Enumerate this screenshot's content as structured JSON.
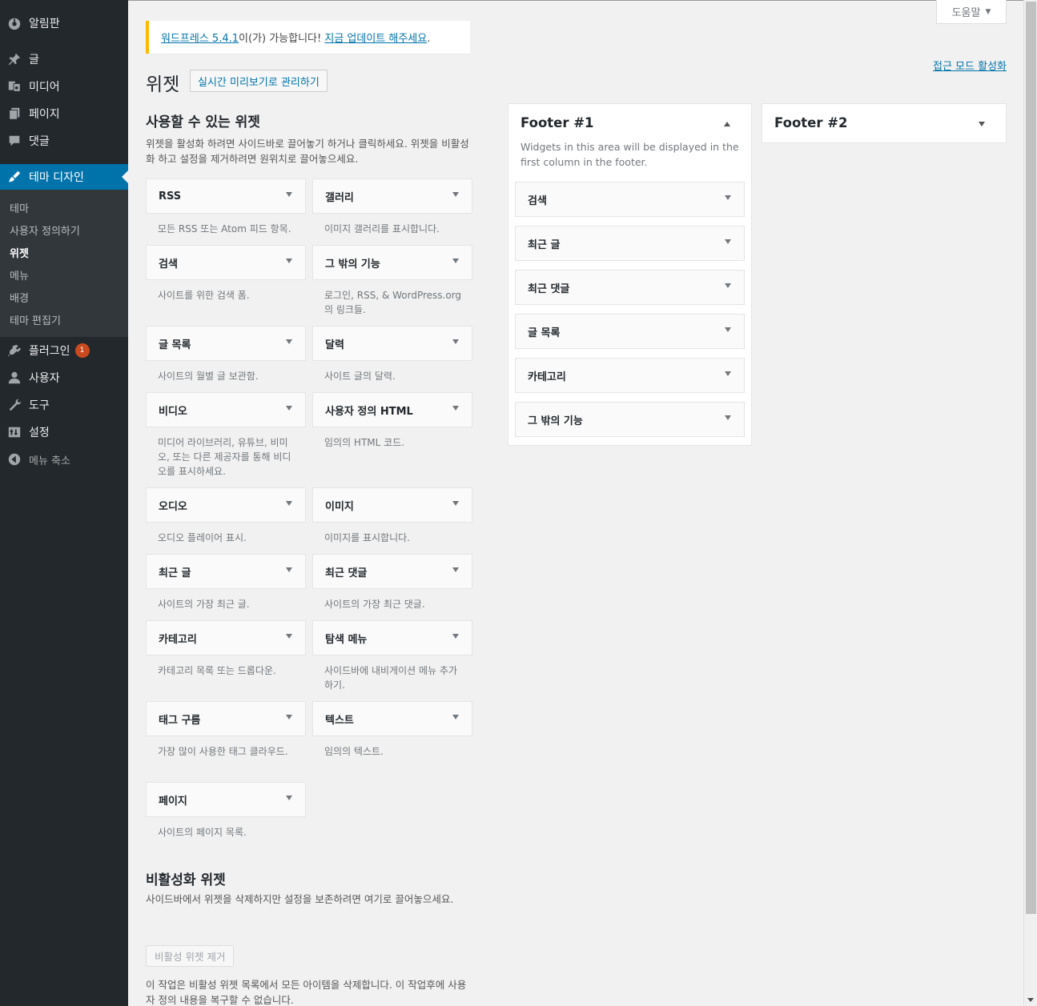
{
  "admin_menu": [
    {
      "label": "알림판",
      "icon": "dashboard-icon"
    },
    {
      "label": "글",
      "icon": "pin-icon"
    },
    {
      "label": "미디어",
      "icon": "media-icon"
    },
    {
      "label": "페이지",
      "icon": "page-icon"
    },
    {
      "label": "댓글",
      "icon": "comment-icon"
    },
    {
      "label": "테마 디자인",
      "icon": "brush-icon"
    },
    {
      "label": "플러그인",
      "icon": "plugin-icon",
      "badge": "1"
    },
    {
      "label": "사용자",
      "icon": "user-icon"
    },
    {
      "label": "도구",
      "icon": "wrench-icon"
    },
    {
      "label": "설정",
      "icon": "settings-icon"
    },
    {
      "label": "메뉴 축소",
      "icon": "collapse-icon"
    }
  ],
  "submenu": [
    "테마",
    "사용자 정의하기",
    "위젯",
    "메뉴",
    "배경",
    "테마 편집기"
  ],
  "help_tab": "도움말",
  "a11y_link": "접근 모드 활성화",
  "notice": {
    "link1": "워드프레스 5.4.1",
    "middle": "이(가) 가능합니다! ",
    "link2": "지금 업데이트 해주세요",
    "end": "."
  },
  "page_title": "위젯",
  "preview_button": "실시간 미리보기로 관리하기",
  "available": {
    "title": "사용할 수 있는 위젯",
    "description": "위젯을 활성화 하려면 사이드바로 끌어놓기 하거나 클릭하세요. 위젯을 비활성화 하고 설정을 제거하려면 원위치로 끌어놓으세요.",
    "widgets": [
      {
        "name": "RSS",
        "desc": "모든 RSS 또는 Atom 피드 항목."
      },
      {
        "name": "갤러리",
        "desc": "이미지 갤러리를 표시합니다."
      },
      {
        "name": "검색",
        "desc": "사이트를 위한 검색 폼."
      },
      {
        "name": "그 밖의 기능",
        "desc": "로그인, RSS, & WordPress.org의 링크들."
      },
      {
        "name": "글 목록",
        "desc": "사이트의 월별 글 보관함."
      },
      {
        "name": "달력",
        "desc": "사이트 글의 달력."
      },
      {
        "name": "비디오",
        "desc": "미디어 라이브러리, 유튜브, 비미오, 또는 다른 제공자를 통해 비디오를 표시하세요."
      },
      {
        "name": "사용자 정의 HTML",
        "desc": "임의의 HTML 코드."
      },
      {
        "name": "오디오",
        "desc": "오디오 플레이어 표시."
      },
      {
        "name": "이미지",
        "desc": "이미지를 표시합니다."
      },
      {
        "name": "최근 글",
        "desc": "사이트의 가장 최근 글."
      },
      {
        "name": "최근 댓글",
        "desc": "사이트의 가장 최근 댓글."
      },
      {
        "name": "카테고리",
        "desc": "카테고리 목록 또는 드롭다운."
      },
      {
        "name": "탐색 메뉴",
        "desc": "사이드바에 내비게이션 메뉴 추가하기."
      },
      {
        "name": "태그 구름",
        "desc": "가장 많이 사용한 태그 클라우드."
      },
      {
        "name": "텍스트",
        "desc": "임의의 텍스트."
      },
      {
        "name": "페이지",
        "desc": "사이트의 페이지 목록."
      }
    ]
  },
  "footer1": {
    "title": "Footer #1",
    "description": "Widgets in this area will be displayed in the first column in the footer.",
    "widgets": [
      "검색",
      "최근 글",
      "최근 댓글",
      "글 목록",
      "카테고리",
      "그 밖의 기능"
    ]
  },
  "footer2": {
    "title": "Footer #2"
  },
  "inactive": {
    "title": "비활성화 위젯",
    "description": "사이드바에서 위젯을 삭제하지만 설정을 보존하려면 여기로 끌어놓으세요.",
    "clear_button": "비활성 위젯 제거",
    "note": "이 작업은 비활성 위젯 목록에서 모든 아이템을 삭제합니다. 이 작업후에 사용자 정의 내용을 복구할 수 없습니다."
  }
}
